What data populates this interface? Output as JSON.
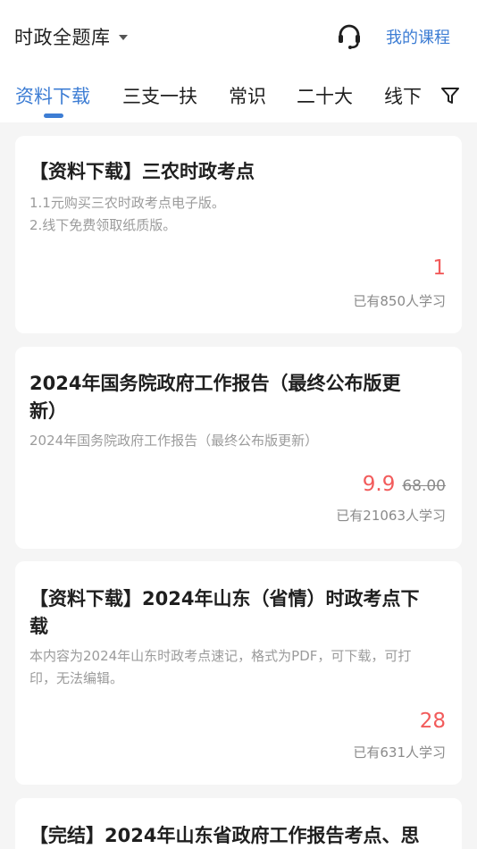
{
  "header": {
    "bank_title": "时政全题库",
    "my_courses": "我的课程"
  },
  "tabs": [
    {
      "label": "资料下载",
      "active": true
    },
    {
      "label": "三支一扶",
      "active": false
    },
    {
      "label": "常识",
      "active": false
    },
    {
      "label": "二十大",
      "active": false
    },
    {
      "label": "线下",
      "active": false
    }
  ],
  "colors": {
    "accent": "#3d7dd4",
    "price": "#f25b5b"
  },
  "cards": [
    {
      "title": "【资料下载】三农时政考点",
      "desc_lines": [
        "1.1元购买三农时政考点电子版。",
        "2.线下免费领取纸质版。"
      ],
      "price": "1",
      "learners": "已有850人学习"
    },
    {
      "title_lines": [
        "2024年国务院政府工作报告（最终公布版更",
        "新）"
      ],
      "desc": "2024年国务院政府工作报告（最终公布版更新）",
      "price": "9.9",
      "original_price": "68.00",
      "learners": "已有21063人学习"
    },
    {
      "title_lines": [
        "【资料下载】2024年山东（省情）时政考点下",
        "载"
      ],
      "desc_lines": [
        "本内容为2024年山东时政考点速记，格式为PDF，可下载，可打",
        "印，无法编辑。"
      ],
      "price": "28",
      "learners": "已有631人学习"
    },
    {
      "title": "【完结】2024年山东省政府工作报告考点、思"
    }
  ]
}
